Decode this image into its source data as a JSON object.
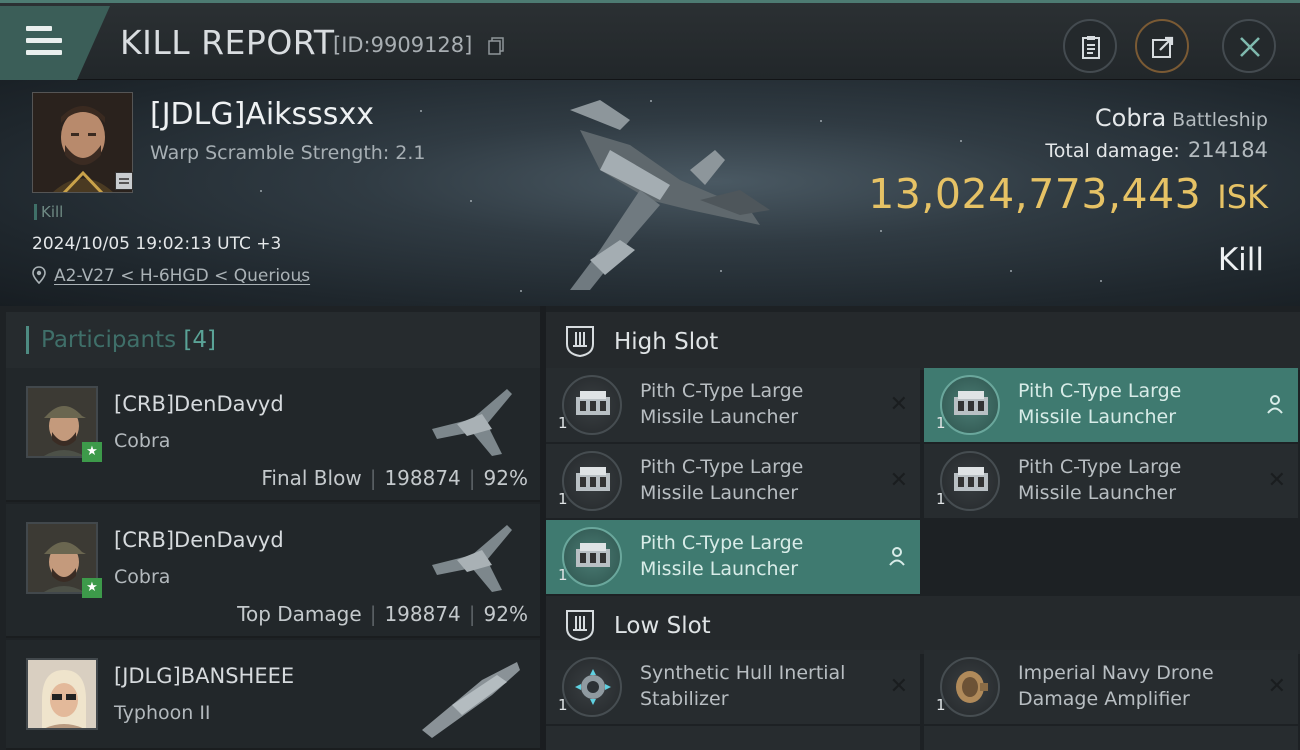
{
  "header": {
    "title": "KILL REPORT",
    "report_id": "[ID:9909128]",
    "buttons": {
      "clipboard": "clipboard-icon",
      "share": "share-icon",
      "close": "close-icon"
    }
  },
  "victim": {
    "name": "[JDLG]Aiksssxx",
    "warp_scramble": "Warp Scramble Strength: 2.1",
    "kill_tag": "Kill",
    "datetime": "2024/10/05 19:02:13 UTC +3",
    "location": "A2-V27 < H-6HGD < Querious"
  },
  "ship": {
    "name": "Cobra",
    "class": "Battleship",
    "total_damage_label": "Total damage:",
    "total_damage": "214184",
    "isk_value": "13,024,773,443",
    "isk_unit": "ISK",
    "kill_type": "Kill"
  },
  "participants": {
    "label": "Participants",
    "count": "[4]",
    "items": [
      {
        "name": "[CRB]DenDavyd",
        "ship": "Cobra",
        "role": "Final Blow",
        "damage": "198874",
        "percent": "92%"
      },
      {
        "name": "[CRB]DenDavyd",
        "ship": "Cobra",
        "role": "Top Damage",
        "damage": "198874",
        "percent": "92%"
      },
      {
        "name": "[JDLG]BANSHEEE",
        "ship": "Typhoon II",
        "role": "",
        "damage": "",
        "percent": ""
      }
    ]
  },
  "slots": {
    "high": {
      "label": "High Slot",
      "modules": [
        {
          "line1": "Pith C-Type Large",
          "line2": "Missile Launcher",
          "qty": "1",
          "status": "destroyed"
        },
        {
          "line1": "Pith C-Type Large",
          "line2": "Missile Launcher",
          "qty": "1",
          "status": "dropped"
        },
        {
          "line1": "Pith C-Type Large",
          "line2": "Missile Launcher",
          "qty": "1",
          "status": "destroyed"
        },
        {
          "line1": "Pith C-Type Large",
          "line2": "Missile Launcher",
          "qty": "1",
          "status": "destroyed"
        },
        {
          "line1": "Pith C-Type Large",
          "line2": "Missile Launcher",
          "qty": "1",
          "status": "dropped"
        }
      ]
    },
    "low": {
      "label": "Low Slot",
      "modules": [
        {
          "line1": "Synthetic Hull Inertial",
          "line2": "Stabilizer",
          "qty": "1",
          "status": "destroyed"
        },
        {
          "line1": "Imperial Navy Drone",
          "line2": "Damage Amplifier",
          "qty": "1",
          "status": "destroyed"
        }
      ]
    }
  },
  "colors": {
    "accent": "#3f7a70",
    "isk": "#e6c265",
    "share_ring": "#7a5a34"
  }
}
